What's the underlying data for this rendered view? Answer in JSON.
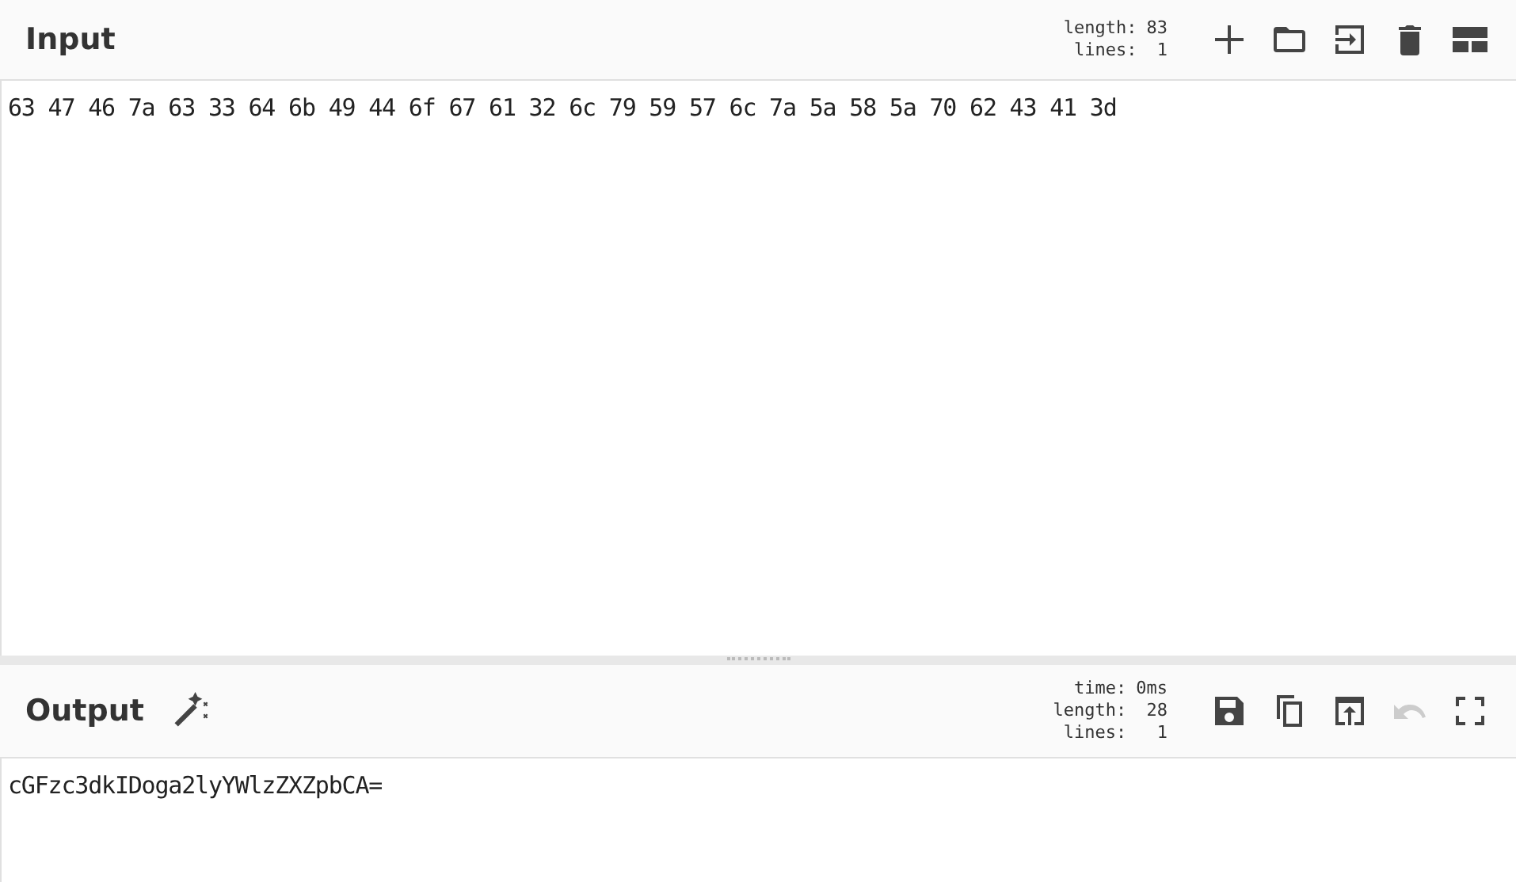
{
  "input": {
    "title": "Input",
    "stats": [
      {
        "label": "length:",
        "value": "83"
      },
      {
        "label": "lines:",
        "value": "1"
      }
    ],
    "buttons": [
      {
        "kind": "add",
        "disabled": false
      },
      {
        "kind": "folder",
        "disabled": false
      },
      {
        "kind": "import",
        "disabled": false
      },
      {
        "kind": "trash",
        "disabled": false
      },
      {
        "kind": "layout",
        "disabled": false
      }
    ],
    "text": "63 47 46 7a 63 33 64 6b 49 44 6f 67 61 32 6c 79 59 57 6c 7a 5a 58 5a 70 62 43 41 3d"
  },
  "output": {
    "title": "Output",
    "magic": true,
    "stats": [
      {
        "label": "time:",
        "value": "0ms"
      },
      {
        "label": "length:",
        "value": "28"
      },
      {
        "label": "lines:",
        "value": "1"
      }
    ],
    "buttons": [
      {
        "kind": "save",
        "disabled": false
      },
      {
        "kind": "copy",
        "disabled": false
      },
      {
        "kind": "replace",
        "disabled": false
      },
      {
        "kind": "undo",
        "disabled": true
      },
      {
        "kind": "fullscreen",
        "disabled": false
      }
    ],
    "text": "cGFzc3dkIDoga2lyYWlzZXZpbCA="
  }
}
